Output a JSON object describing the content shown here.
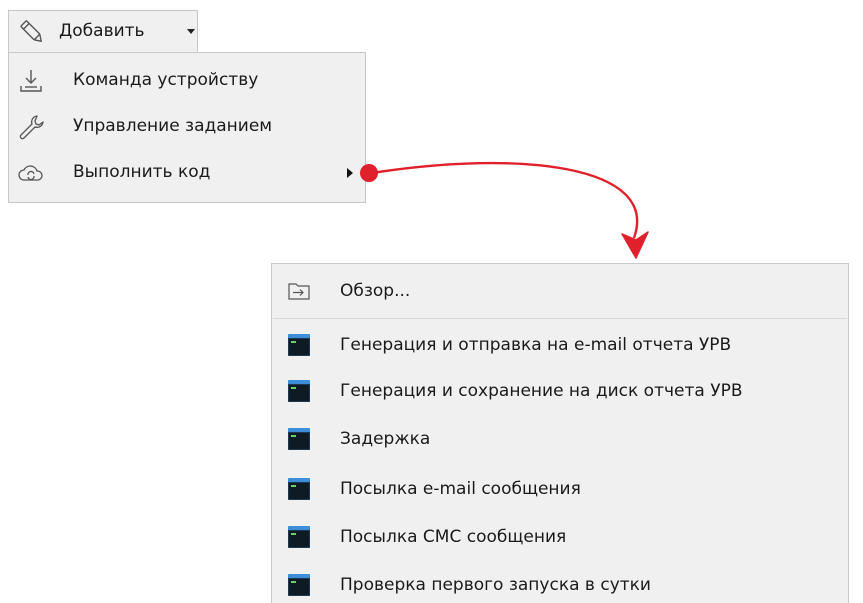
{
  "toolbar": {
    "add_button": {
      "label": "Добавить",
      "icon": "pencil-icon"
    }
  },
  "menu_add": {
    "items": [
      {
        "label": "Команда устройству",
        "icon": "download-tray-icon"
      },
      {
        "label": "Управление заданием",
        "icon": "wrench-icon"
      },
      {
        "label": "Выполнить код",
        "icon": "cloud-refresh-icon",
        "has_submenu": true
      }
    ]
  },
  "menu_code": {
    "browse": {
      "label": "Обзор...",
      "icon": "folder-arrow-icon"
    },
    "scripts": [
      {
        "label": "Генерация и отправка на e-mail отчета УРВ",
        "icon": "terminal-icon"
      },
      {
        "label": "Генерация и сохранение на диск отчета УРВ",
        "icon": "terminal-icon"
      },
      {
        "label": "Задержка",
        "icon": "terminal-icon"
      },
      {
        "label": "Посылка e-mail сообщения",
        "icon": "terminal-icon"
      },
      {
        "label": "Посылка СМС сообщения",
        "icon": "terminal-icon"
      },
      {
        "label": "Проверка первого запуска в сутки",
        "icon": "terminal-icon"
      }
    ]
  },
  "colors": {
    "menu_bg": "#f0f0f0",
    "menu_border": "#c8c8c8",
    "callout": "#e0202a"
  }
}
